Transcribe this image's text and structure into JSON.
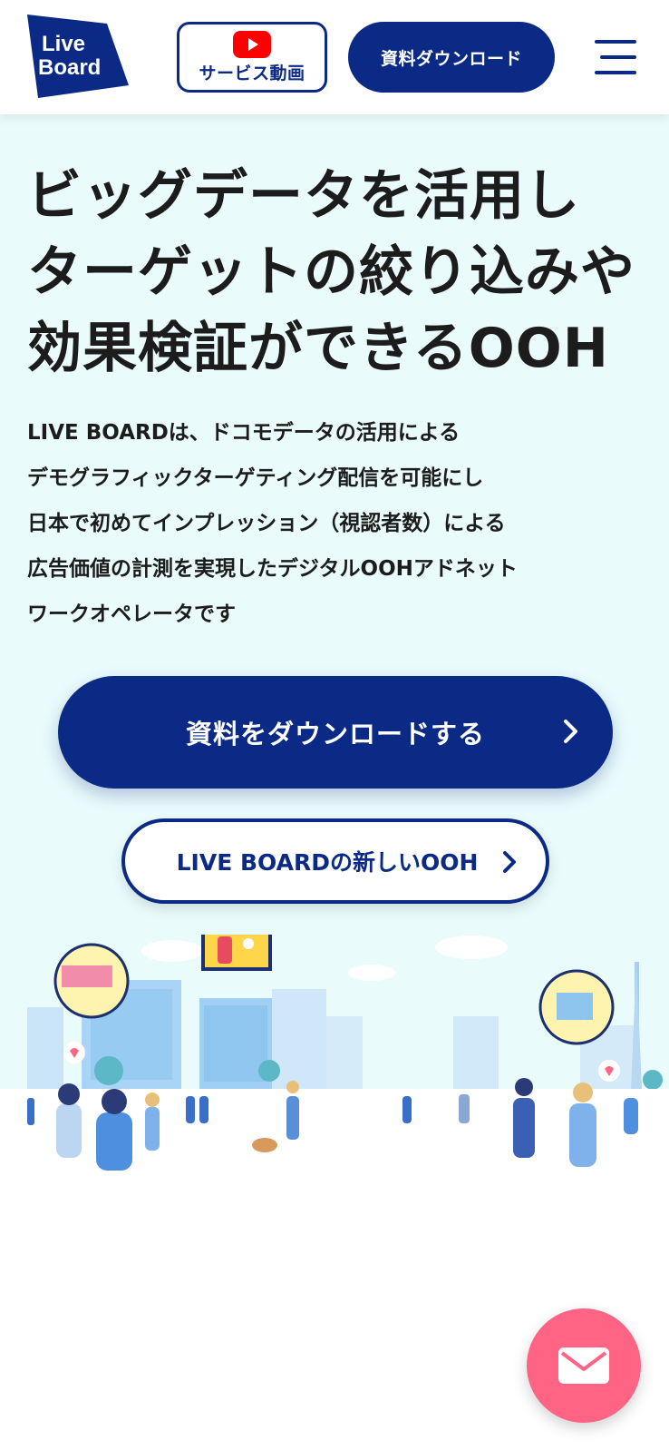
{
  "header": {
    "logo_line1": "Live",
    "logo_line2": "Board",
    "video_label": "サービス動画",
    "download_label": "資料ダウンロード",
    "menu_icon": "hamburger-menu-icon"
  },
  "hero": {
    "headline": [
      "ビッグデータを活用し",
      "ターゲットの絞り込みや",
      "効果検証ができるOOH"
    ],
    "description": [
      "LIVE BOARDは、ドコモデータの活用による",
      "デモグラフィックターゲティング配信を可能にし",
      "日本で初めてインプレッション（視認者数）による",
      "広告価値の計測を実現したデジタルOOHアドネット",
      "ワークオペレータです"
    ],
    "cta_primary": "資料をダウンロードする",
    "cta_secondary": "LIVE BOARDの新しいOOH"
  },
  "fab": {
    "icon": "mail-icon"
  },
  "colors": {
    "brand_navy": "#0b2a85",
    "hero_bg": "#e9fbfb",
    "fab_pink": "#ff6484",
    "youtube_red": "#ff0000"
  }
}
